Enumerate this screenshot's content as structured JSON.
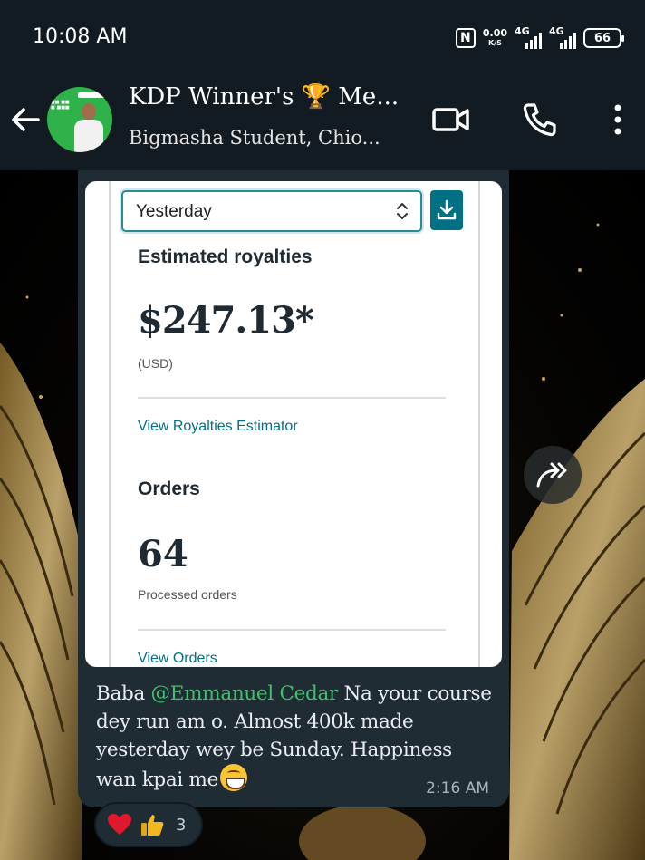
{
  "status_bar": {
    "time": "10:08 AM",
    "net_speed_value": "0.00",
    "net_speed_unit": "K/S",
    "network_1": "4G",
    "network_2": "4G",
    "battery": "66"
  },
  "chat_header": {
    "title": "KDP Winner's 🏆 Me...",
    "subtitle": "Bigmasha Student, Chio...",
    "icons": [
      "back-arrow-icon",
      "video-call-icon",
      "phone-icon",
      "more-vertical-icon"
    ]
  },
  "message": {
    "screenshot": {
      "period_select": "Yesterday",
      "estimated_label": "Estimated royalties",
      "royalty_amount": "$247.13*",
      "currency": "(USD)",
      "royalties_link": "View Royalties Estimator",
      "orders_label": "Orders",
      "orders_count": "64",
      "processed_label": "Processed orders",
      "orders_link": "View Orders"
    },
    "caption_prefix": "Baba ",
    "mention": "@Emmanuel Cedar",
    "caption_body": " Na your course dey run am o. Almost 400k made yesterday wey be Sunday. Happiness wan kpai me",
    "emoji": "grinning-face-emoji",
    "time": "2:16 AM"
  },
  "reactions": {
    "emojis": [
      "red-heart",
      "thumbs-up"
    ],
    "count": "3"
  },
  "colors": {
    "header_bg": "#111b21",
    "bubble_bg": "#202c33",
    "mention": "#3ec16b",
    "amazon_teal": "#007185"
  }
}
